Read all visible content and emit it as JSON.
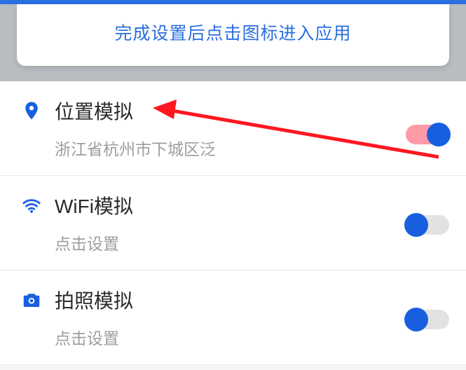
{
  "banner": {
    "text": "完成设置后点击图标进入应用"
  },
  "items": [
    {
      "icon": "location-pin-icon",
      "title": "位置模拟",
      "sub": "浙江省杭州市下城区泛",
      "toggle_on": true,
      "toggle_style": "right-pink"
    },
    {
      "icon": "wifi-icon",
      "title": "WiFi模拟",
      "sub": "点击设置",
      "toggle_on": true,
      "toggle_style": "left-blue"
    },
    {
      "icon": "camera-icon",
      "title": "拍照模拟",
      "sub": "点击设置",
      "toggle_on": true,
      "toggle_style": "left-blue"
    }
  ]
}
